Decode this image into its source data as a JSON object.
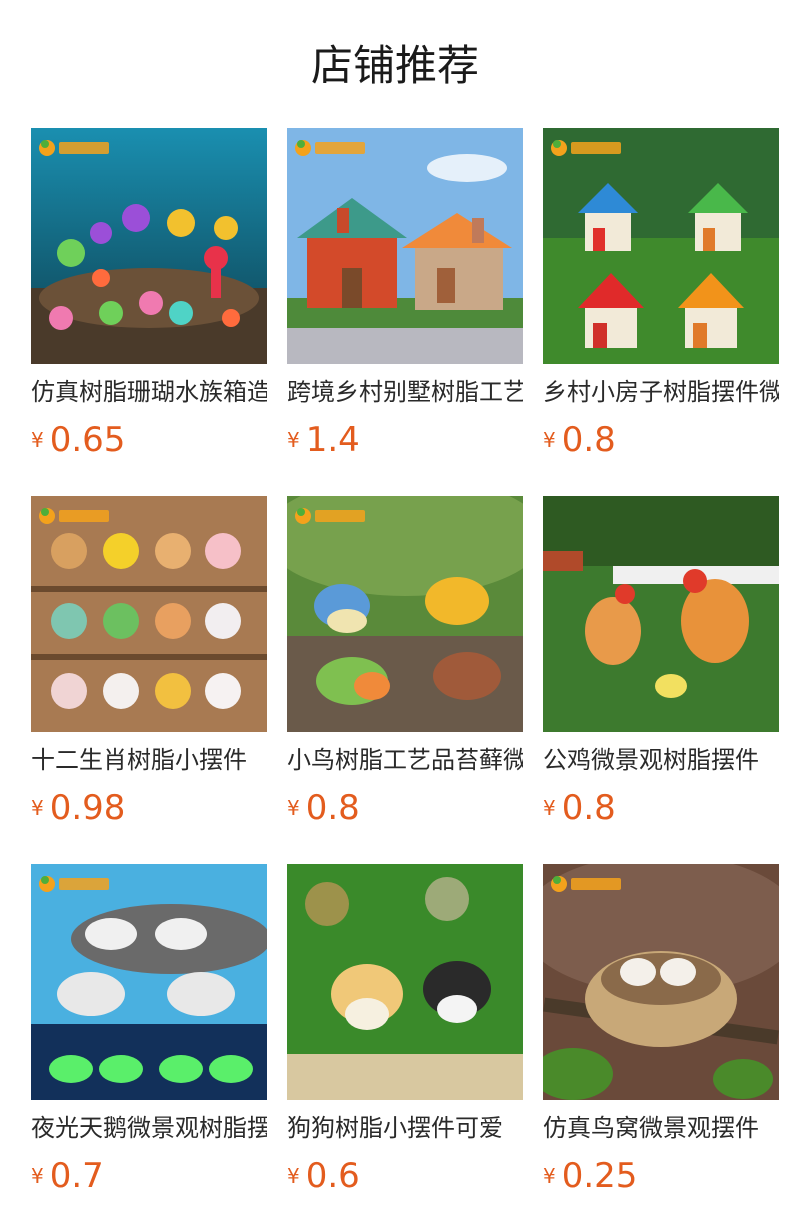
{
  "header": {
    "title": "店铺推荐"
  },
  "currency_symbol": "¥",
  "colors": {
    "price": "#e35c1e",
    "text": "#2a2a2a"
  },
  "products": [
    {
      "name": "仿真树脂珊瑚水族箱造景",
      "price": "0.65",
      "image": "coral-aquarium"
    },
    {
      "name": "跨境乡村别墅树脂工艺品",
      "price": "1.4",
      "image": "village-cottages"
    },
    {
      "name": "乡村小房子树脂摆件微景观",
      "price": "0.8",
      "image": "colored-houses"
    },
    {
      "name": "十二生肖树脂小摆件",
      "price": "0.98",
      "image": "zodiac-figures"
    },
    {
      "name": "小鸟树脂工艺品苔藓微景观",
      "price": "0.8",
      "image": "resin-birds"
    },
    {
      "name": "公鸡微景观树脂摆件",
      "price": "0.8",
      "image": "roosters"
    },
    {
      "name": "夜光天鹅微景观树脂摆件",
      "price": "0.7",
      "image": "glow-swans"
    },
    {
      "name": "狗狗树脂小摆件可爱",
      "price": "0.6",
      "image": "puppies"
    },
    {
      "name": "仿真鸟窝微景观摆件",
      "price": "0.25",
      "image": "bird-nest"
    }
  ]
}
